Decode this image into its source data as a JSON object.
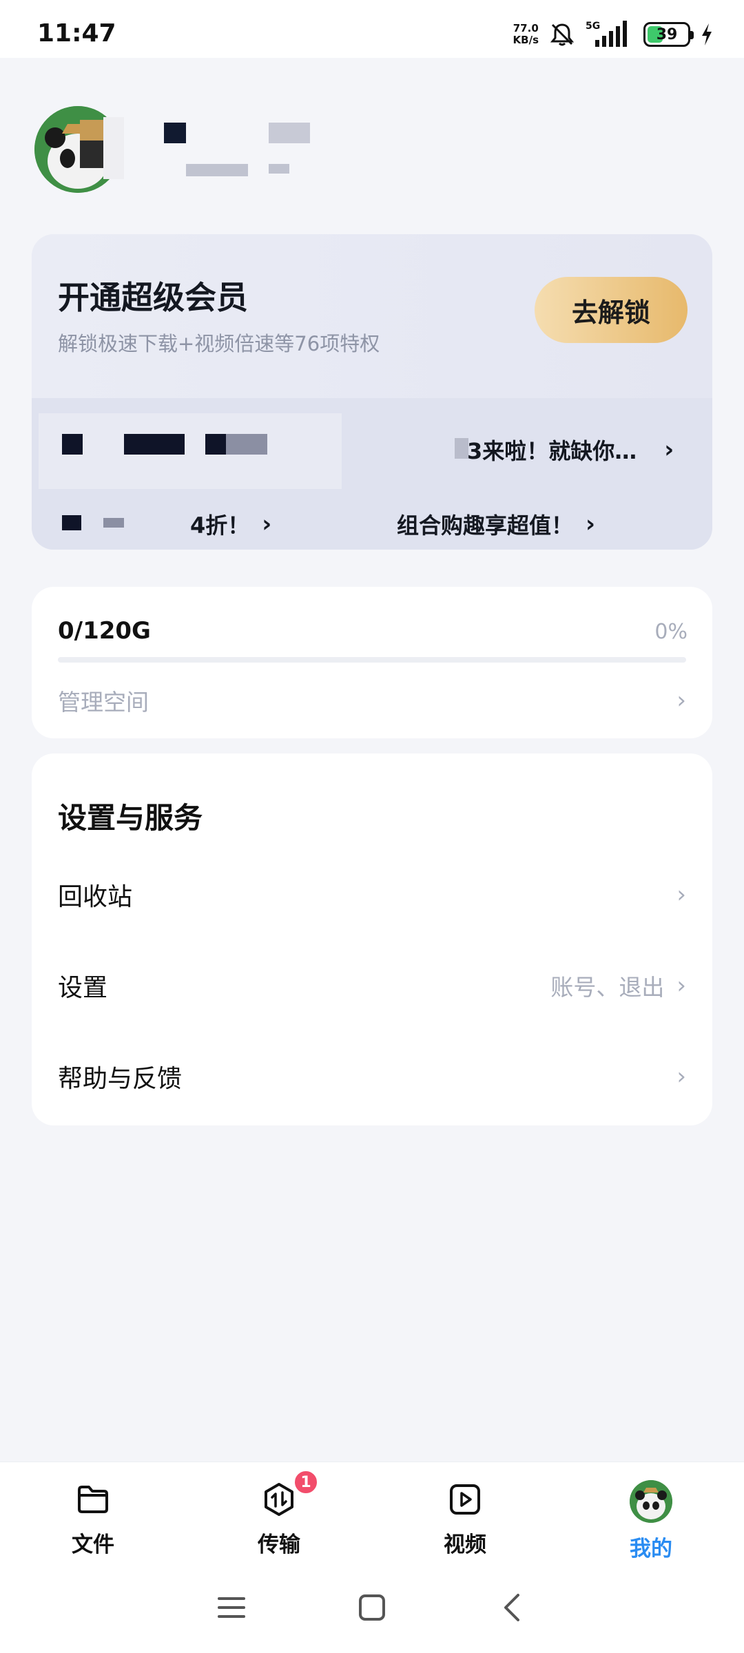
{
  "status_bar": {
    "time": "11:47",
    "net_speed_value": "77.0",
    "net_speed_unit": "KB/s",
    "network_type": "5G",
    "battery": "39",
    "battery_level": 0.39,
    "icons": [
      "mute-bell-icon",
      "signal-icon",
      "battery-icon",
      "charging-icon"
    ]
  },
  "profile": {
    "name_partial": "139",
    "avatar_icon": "panda-avatar"
  },
  "vip": {
    "title": "开通超级会员",
    "subtitle": "解锁极速下载+视频倍速等76项特权",
    "unlock_button": "去解锁",
    "promo_1_tail": "3来啦！就缺你…",
    "promo_2_tail": "4折！",
    "promo_3": "组合购趣享超值！"
  },
  "storage": {
    "used": "0/120G",
    "percent": "0%",
    "fill_fraction": 0,
    "manage_label": "管理空间"
  },
  "settings": {
    "title": "设置与服务",
    "rows": [
      {
        "label": "回收站",
        "extra": ""
      },
      {
        "label": "设置",
        "extra": "账号、退出"
      },
      {
        "label": "帮助与反馈",
        "extra": ""
      }
    ]
  },
  "bottom_nav": {
    "items": [
      {
        "label": "文件",
        "icon": "folder-icon"
      },
      {
        "label": "传输",
        "icon": "transfer-icon",
        "badge": "1"
      },
      {
        "label": "视频",
        "icon": "video-icon"
      },
      {
        "label": "我的",
        "icon": "profile-avatar-icon",
        "active": true
      }
    ]
  },
  "colors": {
    "accent": "#2a8cf2",
    "badge": "#f24d6b",
    "gold_start": "#f5ddb0",
    "gold_end": "#e7b96c"
  }
}
